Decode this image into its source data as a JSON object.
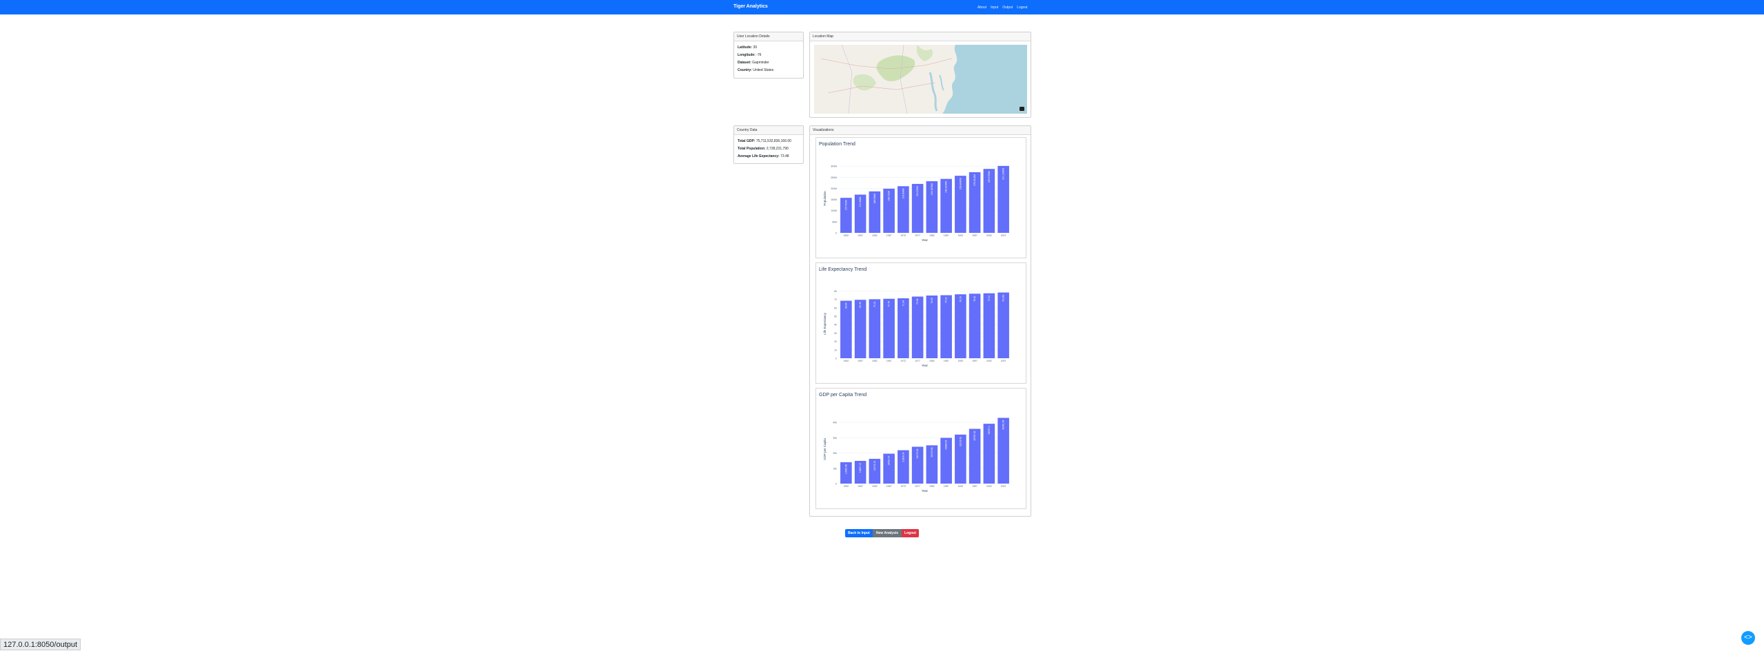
{
  "nav": {
    "brand": "Tiger Analytics",
    "links": [
      "About",
      "Input",
      "Output",
      "Logout"
    ]
  },
  "user_location": {
    "header": "User Location Details",
    "latitude_label": "Latitude:",
    "latitude_value": "39",
    "longitude_label": "Longitude:",
    "longitude_value": "-76",
    "dataset_label": "Dataset:",
    "dataset_value": "Gapminder",
    "country_label": "Country:",
    "country_value": "United States"
  },
  "location_map": {
    "header": "Location Map"
  },
  "country_data": {
    "header": "Country Data",
    "gdp_label": "Total GDP:",
    "gdp_value": "75,711,532,836,166.00",
    "population_label": "Total Population:",
    "population_value": "2,738,231,790",
    "life_label": "Average Life Expectancy:",
    "life_value": "73.48"
  },
  "visualizations": {
    "header": "Visualizations"
  },
  "colors": {
    "navbar": "#0d6efd",
    "bar": "#636efa",
    "btn_primary": "#0d6efd",
    "btn_secondary": "#6c757d",
    "btn_danger": "#dc3545"
  },
  "chart_data": [
    {
      "type": "bar",
      "title": "Population Trend",
      "xlabel": "Year",
      "ylabel": "Population",
      "categories": [
        "1952",
        "1957",
        "1962",
        "1967",
        "1972",
        "1977",
        "1982",
        "1987",
        "1992",
        "1997",
        "2002",
        "2007"
      ],
      "values": [
        157553000,
        171984000,
        186538000,
        198712000,
        209896000,
        220239000,
        232187835,
        242803533,
        256894189,
        272911760,
        287675526,
        301139947
      ],
      "labels": [
        "157.553M",
        "171.984M",
        "186.538M",
        "198.712M",
        "209.896M",
        "220.239M",
        "232.1878M",
        "242.8035M",
        "256.8942M",
        "272.9118M",
        "287.6755M",
        "301.1399M"
      ],
      "ylim": [
        0,
        310000000
      ],
      "yticks": [
        "0",
        "50M",
        "100M",
        "150M",
        "200M",
        "250M",
        "300M"
      ]
    },
    {
      "type": "bar",
      "title": "Life Expectancy Trend",
      "xlabel": "Year",
      "ylabel": "Life Expectancy",
      "categories": [
        "1952",
        "1957",
        "1962",
        "1967",
        "1972",
        "1977",
        "1982",
        "1987",
        "1992",
        "1997",
        "2002",
        "2007"
      ],
      "values": [
        68.44,
        69.49,
        70.21,
        70.76,
        71.34,
        73.38,
        74.65,
        75.02,
        76.09,
        76.81,
        77.31,
        78.242
      ],
      "labels": [
        "68.44",
        "69.49",
        "70.21",
        "70.76",
        "71.34",
        "73.38",
        "74.65",
        "75.02",
        "76.09",
        "76.81",
        "77.31",
        "78.242"
      ],
      "ylim": [
        0,
        82
      ],
      "yticks": [
        "0",
        "10",
        "20",
        "30",
        "40",
        "50",
        "60",
        "70",
        "80"
      ]
    },
    {
      "type": "bar",
      "title": "GDP per Capita Trend",
      "xlabel": "Year",
      "ylabel": "GDP per Capita",
      "categories": [
        "1952",
        "1957",
        "1962",
        "1967",
        "1972",
        "1977",
        "1982",
        "1987",
        "1992",
        "1997",
        "2002",
        "2007"
      ],
      "values": [
        13990.48,
        14847.13,
        16173.15,
        19530.37,
        21806.04,
        24072.63,
        25009.56,
        29884.35,
        32003.93,
        35767.43,
        39097.1,
        42951.65
      ],
      "labels": [
        "13990.48",
        "14847.13",
        "16173.15",
        "19530.37",
        "21806.04",
        "24072.63",
        "25009.56",
        "29884.35",
        "32003.93",
        "35767.43",
        "39097.1",
        "42951.65"
      ],
      "ylim": [
        0,
        45000
      ],
      "yticks": [
        "0",
        "10k",
        "20k",
        "30k",
        "40k"
      ]
    }
  ],
  "buttons": {
    "back": "Back to Input",
    "new_analysis": "New Analysis",
    "logout": "Logout"
  },
  "status_url": "127.0.0.1:8050/output",
  "fab_label": "<>"
}
